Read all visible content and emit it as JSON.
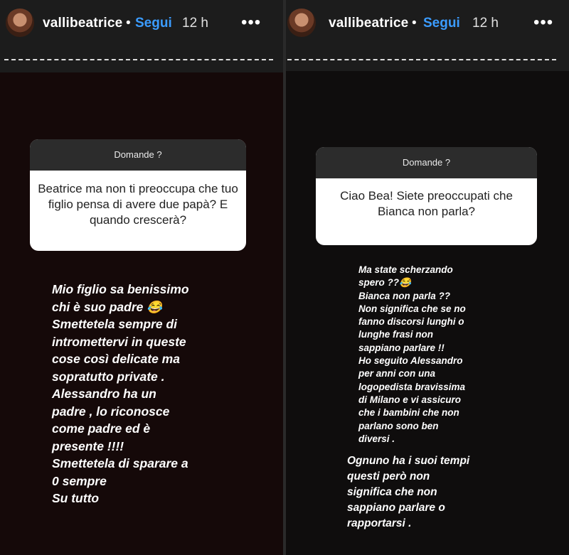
{
  "left": {
    "username": "vallibeatrice",
    "follow_label": "Segui",
    "time": "12 h",
    "more": "•••",
    "question_header": "Domande ?",
    "question_text": "Beatrice ma non ti preoccupa che tuo figlio pensa di avere due papà? E quando crescerà?",
    "answer": "Mio figlio sa benissimo\nchi è suo padre 😂\nSmettetela sempre di\nintromettervi in queste\ncose così delicate ma\nsopratutto private .\nAlessandro ha un\npadre , lo riconosce\ncome padre ed è\npresente !!!!\nSmettetela di sparare a\n0 sempre\nSu tutto"
  },
  "right": {
    "username": "vallibeatrice",
    "follow_label": "Segui",
    "time": "12 h",
    "more": "•••",
    "question_header": "Domande ?",
    "question_text": "Ciao Bea! Siete preoccupati che Bianca non parla?",
    "answer_1": "Ma state scherzando\nspero ??😂\nBianca non parla ??\nNon significa che se no\nfanno discorsi lunghi o\nlunghe frasi non\nsappiano parlare !!\nHo seguito Alessandro\nper anni con una\nlogopedista bravissima\ndi Milano e vi assicuro\nche i bambini che non\nparlano sono ben\ndiversi .",
    "answer_2": "Ognuno ha i suoi tempi\nquesti però non\nsignifica che non\nsappiano parlare o\nrapportarsi ."
  }
}
